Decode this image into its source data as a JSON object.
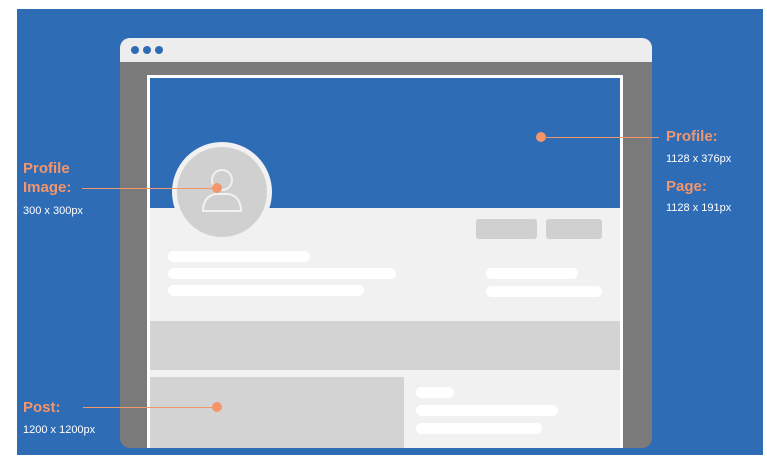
{
  "labels": {
    "profile_image": {
      "title_line1": "Profile",
      "title_line2": "Image:",
      "size": "300 x 300px"
    },
    "profile": {
      "title": "Profile:",
      "size": "1128 x 376px"
    },
    "page": {
      "title": "Page:",
      "size": "1128 x 191px"
    },
    "post": {
      "title": "Post:",
      "size": "1200 x 1200px"
    }
  },
  "colors": {
    "background": "#2e6cb6",
    "accent": "#f4956a",
    "window_frame": "#7a7a7a",
    "placeholder": "#d0d0d0"
  },
  "icons": {
    "window_controls": "window-dots-icon",
    "avatar_placeholder": "user-silhouette-icon"
  }
}
